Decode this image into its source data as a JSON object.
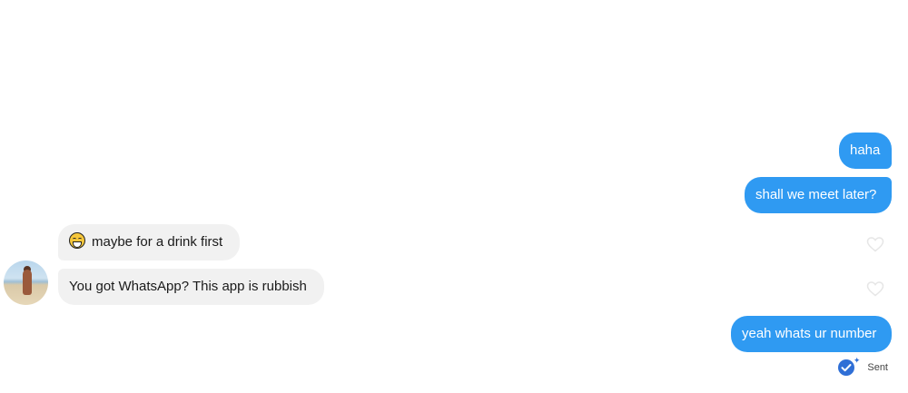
{
  "messages": [
    {
      "id": "m1",
      "direction": "outgoing",
      "text": "haha"
    },
    {
      "id": "m2",
      "direction": "outgoing",
      "text": "shall we meet later?"
    },
    {
      "id": "m3",
      "direction": "incoming",
      "text": "maybe for a drink first",
      "emoji": "tears-of-joy-emoji"
    },
    {
      "id": "m4",
      "direction": "incoming",
      "text": "You got WhatsApp? This app is rubbish"
    },
    {
      "id": "m5",
      "direction": "outgoing",
      "text": "yeah whats ur number"
    }
  ],
  "receipt": {
    "status": "Sent",
    "icon": "sent-check-icon"
  },
  "colors": {
    "outgoing_bubble": "#2f9af2",
    "incoming_bubble": "#f1f1f1",
    "receipt_check": "#2f6fd6"
  }
}
